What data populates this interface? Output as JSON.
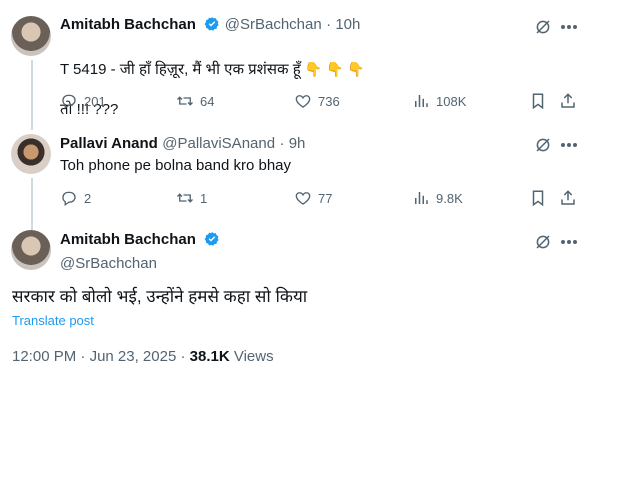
{
  "tweets": [
    {
      "author": "Amitabh Bachchan",
      "handle": "@SrBachchan",
      "time": "10h",
      "line1": "T 5419 - जी हाँ हिज़ूर, मैं भी एक प्रशंसक हूँ",
      "emojis": "👇 👇 👇",
      "line2": "तो !!! ???",
      "replies": "201",
      "reposts": "64",
      "likes": "736",
      "views": "108K"
    },
    {
      "author": "Pallavi Anand",
      "handle": "@PallaviSAnand",
      "time": "9h",
      "text": "Toh phone pe bolna band kro bhay",
      "replies": "2",
      "reposts": "1",
      "likes": "77",
      "views": "9.8K"
    }
  ],
  "main_tweet": {
    "author": "Amitabh Bachchan",
    "handle": "@SrBachchan",
    "text": "सरकार को बोलो भई, उन्होंने हमसे कहा सो किया",
    "translate": "Translate post",
    "time": "12:00 PM",
    "date": "Jun 23, 2025",
    "views_count": "38.1K",
    "views_label": "Views"
  },
  "colors": {
    "verified": "#1d9bf0",
    "muted": "#536471",
    "link": "#1d9bf0"
  }
}
